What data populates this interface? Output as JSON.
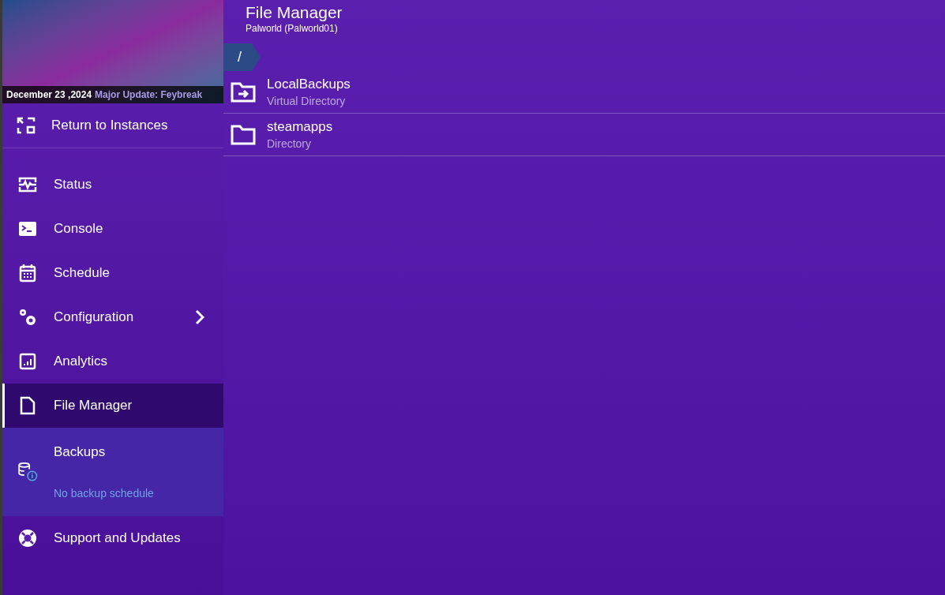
{
  "banner": {
    "date": "December 23 ,2024",
    "headline": "Major Update: Feybreak"
  },
  "return_link": {
    "label": "Return to Instances"
  },
  "nav": [
    {
      "label": "Status",
      "kind": "link",
      "selected": false
    },
    {
      "label": "Console",
      "kind": "link",
      "selected": false
    },
    {
      "label": "Schedule",
      "kind": "link",
      "selected": false
    },
    {
      "label": "Configuration",
      "kind": "submenu",
      "selected": false
    },
    {
      "label": "Analytics",
      "kind": "link",
      "selected": false
    },
    {
      "label": "File Manager",
      "kind": "link",
      "selected": true
    },
    {
      "label": "Backups",
      "kind": "backup",
      "note": "No backup schedule",
      "selected": false
    },
    {
      "label": "Support and Updates",
      "kind": "link",
      "selected": false
    }
  ],
  "header": {
    "title": "File Manager",
    "subtitle": "Palworld (Palworld01)"
  },
  "breadcrumb": [
    "/"
  ],
  "entries": [
    {
      "name": "LocalBackups",
      "type": "Virtual Directory",
      "kind": "virtual"
    },
    {
      "name": "steamapps",
      "type": "Directory",
      "kind": "folder"
    }
  ]
}
